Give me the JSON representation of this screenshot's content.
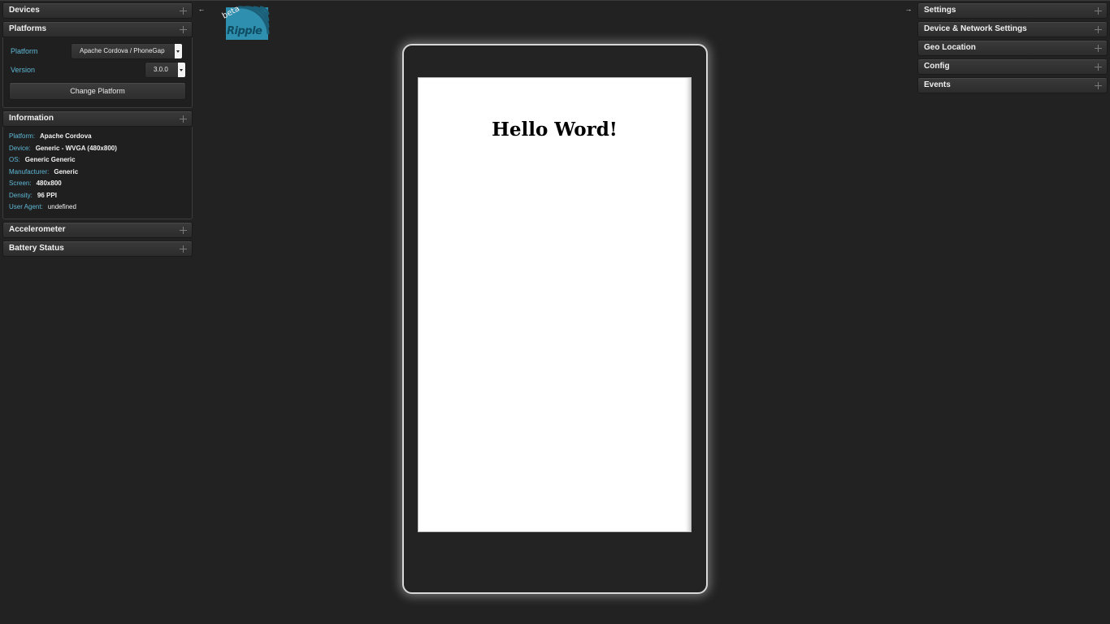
{
  "left_panels": {
    "devices": {
      "title": "Devices"
    },
    "platforms": {
      "title": "Platforms",
      "platform_label": "Platform",
      "platform_value": "Apache Cordova / PhoneGap",
      "version_label": "Version",
      "version_value": "3.0.0",
      "change_button": "Change Platform"
    },
    "information": {
      "title": "Information",
      "rows": [
        {
          "key": "Platform:",
          "value": "Apache Cordova"
        },
        {
          "key": "Device:",
          "value": "Generic - WVGA (480x800)"
        },
        {
          "key": "OS:",
          "value": "Generic Generic"
        },
        {
          "key": "Manufacturer:",
          "value": "Generic"
        },
        {
          "key": "Screen:",
          "value": "480x800"
        },
        {
          "key": "Density:",
          "value": "96 PPI"
        },
        {
          "key": "User Agent:",
          "value": "undefined"
        }
      ]
    },
    "accelerometer": {
      "title": "Accelerometer"
    },
    "battery": {
      "title": "Battery Status"
    }
  },
  "right_panels": {
    "settings": {
      "title": "Settings"
    },
    "network": {
      "title": "Device & Network Settings"
    },
    "geo": {
      "title": "Geo Location"
    },
    "config": {
      "title": "Config"
    },
    "events": {
      "title": "Events"
    }
  },
  "toggles": {
    "left_arrow": "←",
    "right_arrow": "→"
  },
  "logo": {
    "badge": "beta",
    "name": "Ripple",
    "color": "#2f8fae"
  },
  "app": {
    "heading": "Hello Word!"
  },
  "colors": {
    "accent": "#5fb8d6",
    "background": "#222222"
  }
}
